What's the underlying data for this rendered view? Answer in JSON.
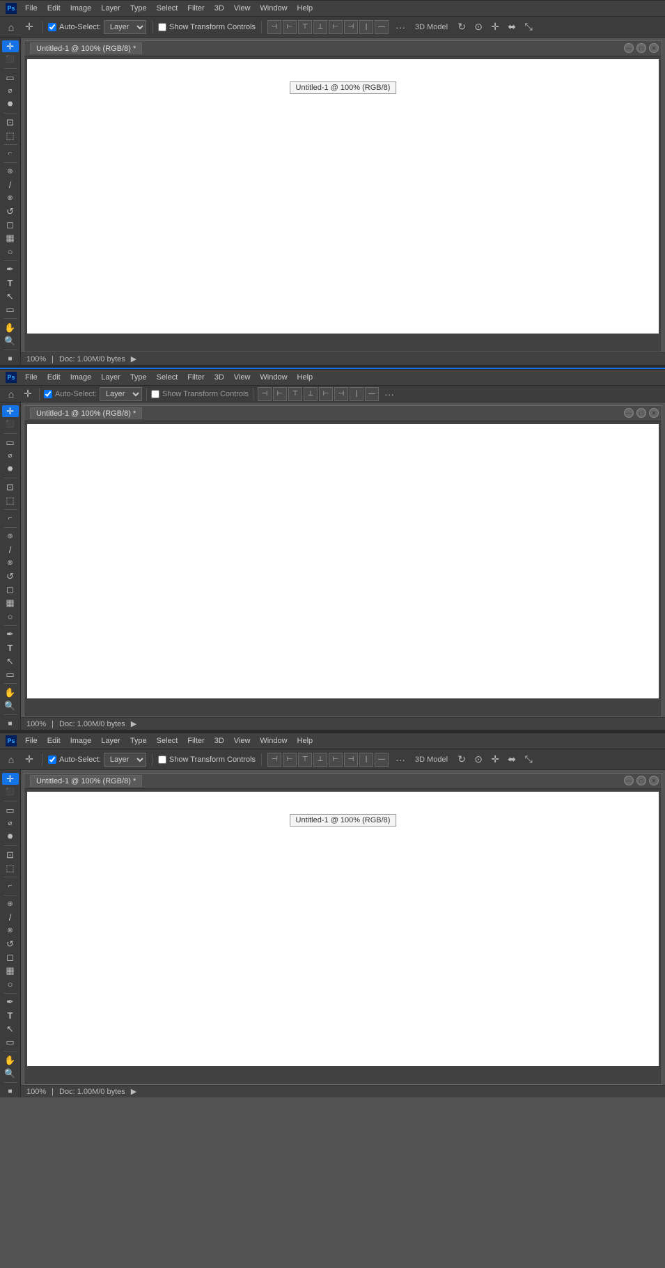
{
  "topToolbar": {
    "autoSelect": true,
    "autoSelectLabel": "Auto-Select:",
    "layerLabel": "Layer",
    "showTransformControls": "Show Transform Controls",
    "dots": "···",
    "threeDModel": "3D Model"
  },
  "menuBar": {
    "items": [
      "File",
      "Edit",
      "Image",
      "Layer",
      "Type",
      "Select",
      "Filter",
      "3D",
      "View",
      "Window",
      "Help"
    ]
  },
  "canvas": {
    "title": "Untitled-1 @ 100% (RGB/8) *",
    "tooltip": "Untitled-1 @ 100% (RGB/8)",
    "zoom": "100%",
    "docSize": "Doc: 1.00M/0 bytes"
  },
  "tools": [
    {
      "name": "move",
      "icon": "✛"
    },
    {
      "name": "artboard",
      "icon": "⬛"
    },
    {
      "name": "marquee-rect",
      "icon": "▭"
    },
    {
      "name": "lasso",
      "icon": "⌀"
    },
    {
      "name": "quick-select",
      "icon": "⬣"
    },
    {
      "name": "crop",
      "icon": "⊡"
    },
    {
      "name": "frame",
      "icon": "⬚"
    },
    {
      "name": "eyedropper",
      "icon": "⌐"
    },
    {
      "name": "spot-heal",
      "icon": "⊕"
    },
    {
      "name": "brush",
      "icon": "/"
    },
    {
      "name": "stamp",
      "icon": "⊗"
    },
    {
      "name": "history-brush",
      "icon": "↺"
    },
    {
      "name": "eraser",
      "icon": "◻"
    },
    {
      "name": "gradient",
      "icon": "▦"
    },
    {
      "name": "dodge",
      "icon": "○"
    },
    {
      "name": "pen",
      "icon": "✒"
    },
    {
      "name": "type",
      "icon": "T"
    },
    {
      "name": "path-select",
      "icon": "↖"
    },
    {
      "name": "shape",
      "icon": "▭"
    },
    {
      "name": "hand",
      "icon": "✋"
    },
    {
      "name": "zoom",
      "icon": "⊕"
    },
    {
      "name": "foreground",
      "icon": "■"
    }
  ]
}
